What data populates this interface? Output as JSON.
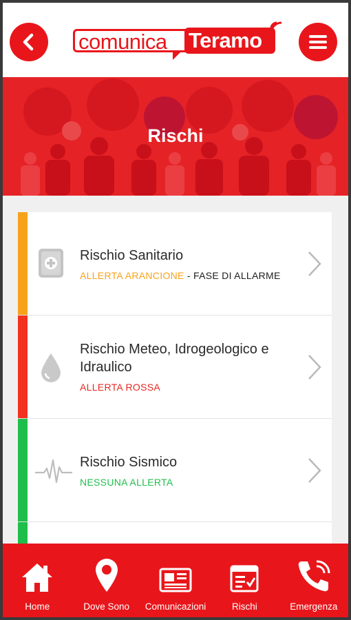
{
  "header": {
    "logo": {
      "part1": "comunica",
      "part2": "Teramo"
    }
  },
  "banner": {
    "title": "Rischi"
  },
  "risks": [
    {
      "title": "Rischio Sanitario",
      "status": "ALLERTA ARANCIONE",
      "separator": " - ",
      "phase": "FASE DI ALLARME",
      "color": "#f7a21b",
      "status_color": "#f7a21b",
      "icon": "medical-kit-icon"
    },
    {
      "title": "Rischio Meteo, Idrogeologico e Idraulico",
      "status": "ALLERTA ROSSA",
      "separator": "",
      "phase": "",
      "color": "#f2311f",
      "status_color": "#e8261f",
      "icon": "water-drop-icon"
    },
    {
      "title": "Rischio Sismico",
      "status": "NESSUNA ALLERTA",
      "separator": "",
      "phase": "",
      "color": "#1fbe4b",
      "status_color": "#1fbe4b",
      "icon": "seismograph-icon"
    }
  ],
  "bottom_nav": [
    {
      "label": "Home",
      "icon": "home-icon"
    },
    {
      "label": "Dove Sono",
      "icon": "location-pin-icon"
    },
    {
      "label": "Comunicazioni",
      "icon": "newspaper-icon"
    },
    {
      "label": "Rischi",
      "icon": "checklist-icon"
    },
    {
      "label": "Emergenza",
      "icon": "phone-icon"
    }
  ],
  "colors": {
    "brand_red": "#e8161b",
    "banner_red": "#e52226"
  }
}
